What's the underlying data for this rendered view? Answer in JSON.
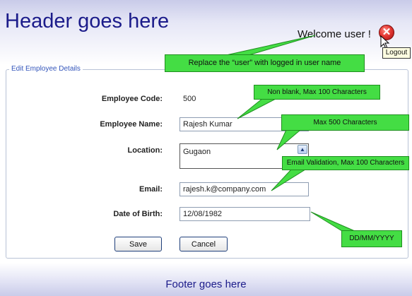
{
  "header": {
    "title": "Header goes here",
    "welcome": "Welcome user !",
    "logout_tooltip": "Logout"
  },
  "form": {
    "legend": "Edit Employee Details",
    "employee_code": {
      "label": "Employee Code:",
      "value": "500"
    },
    "employee_name": {
      "label": "Employee Name:",
      "value": "Rajesh Kumar"
    },
    "location": {
      "label": "Location:",
      "value": "Gugaon"
    },
    "email": {
      "label": "Email:",
      "value": "rajesh.k@company.com"
    },
    "dob": {
      "label": "Date of Birth:",
      "value": "12/08/1982"
    },
    "save_label": "Save",
    "cancel_label": "Cancel"
  },
  "annotations": {
    "user_note": "Replace the “user” with logged in user name",
    "name_note": "Non blank, Max 100 Characters",
    "location_note": "Max 500 Characters",
    "email_note": "Email Validation, Max 100 Characters",
    "dob_note": "DD/MM/YYYY"
  },
  "icons": {
    "logout": "close-circle-icon",
    "cursor": "mouse-pointer-icon",
    "scroll": "chevron-up-icon"
  },
  "colors": {
    "header_text": "#1b1b8a",
    "callout_fill": "#44dd44",
    "logout_red": "#e53935",
    "legend_text": "#3355bb"
  },
  "footer": {
    "text": "Footer goes here"
  }
}
